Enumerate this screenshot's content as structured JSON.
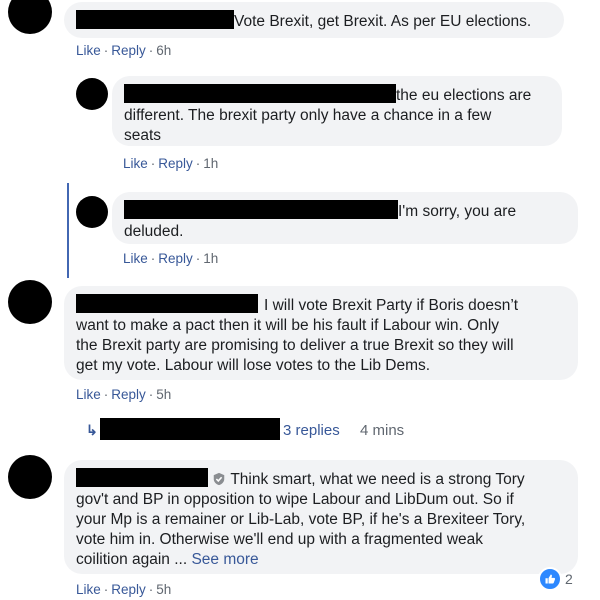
{
  "actions": {
    "like": "Like",
    "reply": "Reply",
    "dot": "·"
  },
  "comments": [
    {
      "text": "Vote Brexit, get Brexit. As per EU elections.",
      "time": "6h"
    },
    {
      "line1": "the eu elections are",
      "line2": "different. The brexit party only have a chance in a few",
      "line3": "seats",
      "time": "1h"
    },
    {
      "line1": "I'm sorry, you are",
      "line2": "deluded.",
      "time": "1h"
    },
    {
      "line1": "I will vote Brexit Party if Boris doesn’t",
      "line2": "want to make a pact then it will be his fault if Labour win. Only",
      "line3": "the Brexit party are promising to deliver a true Brexit so they will",
      "line4": "get my vote. Labour will lose votes to the Lib Dems.",
      "time": "5h",
      "replies": {
        "count": "3 replies",
        "time": "4 mins"
      }
    },
    {
      "line1": "Think smart, what we need is a strong Tory",
      "line2": "gov't and BP in opposition to wipe Labour and LibDum out. So if",
      "line3": "your Mp is a remainer or Lib-Lab, vote BP, if he's a Brexiteer Tory,",
      "line4": "vote him in. Otherwise we'll end up with a fragmented weak",
      "line5": "coilition again ...",
      "see_more": "See more",
      "time": "5h",
      "reactions": "2"
    }
  ],
  "icons": {
    "reply_arrow": "reply-arrow-icon",
    "verified": "verified-badge-icon",
    "like_reaction": "like-reaction-icon"
  },
  "colors": {
    "link": "#385898",
    "bubble": "#f2f3f5",
    "thread": "#4267b2",
    "like": "#2d88ff"
  }
}
